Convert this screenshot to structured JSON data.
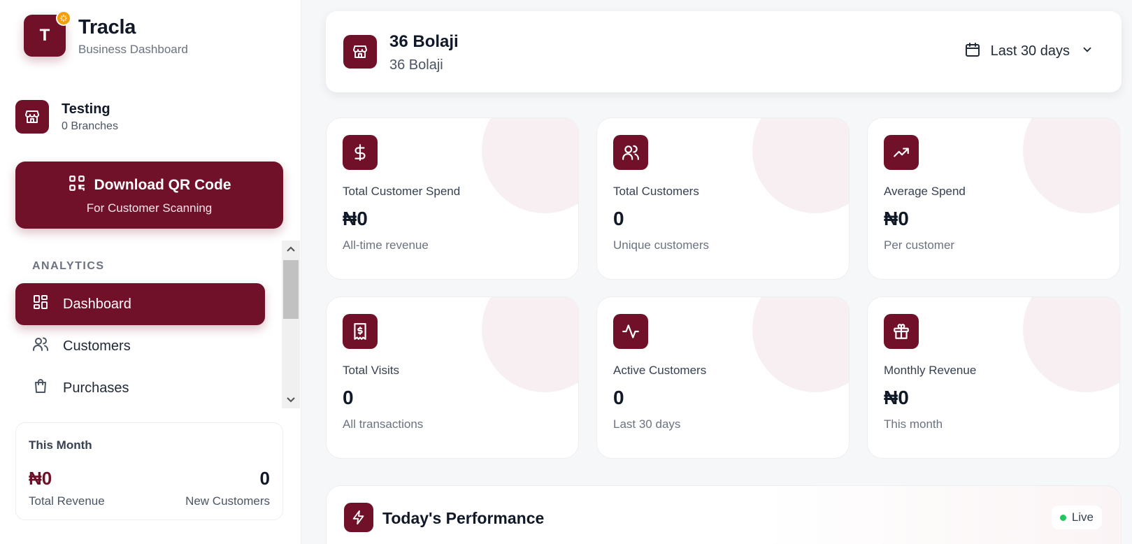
{
  "brand": {
    "initial": "T",
    "name": "Tracla",
    "subtitle": "Business Dashboard"
  },
  "store": {
    "name": "Testing",
    "branches": "0 Branches"
  },
  "qr_button": {
    "label": "Download QR Code",
    "sub": "For Customer Scanning"
  },
  "nav": {
    "section": "ANALYTICS",
    "items": [
      {
        "label": "Dashboard",
        "icon": "dashboard-icon",
        "active": true
      },
      {
        "label": "Customers",
        "icon": "users-icon",
        "active": false
      },
      {
        "label": "Purchases",
        "icon": "shopping-bag-icon",
        "active": false
      }
    ]
  },
  "this_month": {
    "title": "This Month",
    "revenue_value": "₦0",
    "revenue_label": "Total Revenue",
    "new_value": "0",
    "new_label": "New Customers"
  },
  "header": {
    "title": "36 Bolaji",
    "subtitle": "36 Bolaji",
    "date_range": "Last 30 days"
  },
  "stats": [
    {
      "title": "Total Customer Spend",
      "value": "₦0",
      "sub": "All-time revenue",
      "icon": "dollar-icon"
    },
    {
      "title": "Total Customers",
      "value": "0",
      "sub": "Unique customers",
      "icon": "users-icon"
    },
    {
      "title": "Average Spend",
      "value": "₦0",
      "sub": "Per customer",
      "icon": "trending-up-icon"
    },
    {
      "title": "Total Visits",
      "value": "0",
      "sub": "All transactions",
      "icon": "receipt-icon"
    },
    {
      "title": "Active Customers",
      "value": "0",
      "sub": "Last 30 days",
      "icon": "activity-icon"
    },
    {
      "title": "Monthly Revenue",
      "value": "₦0",
      "sub": "This month",
      "icon": "gift-icon"
    }
  ],
  "performance": {
    "title": "Today's Performance",
    "status": "Live"
  },
  "colors": {
    "accent": "#701029",
    "badge": "#f59e0b",
    "live": "#22c55e"
  }
}
